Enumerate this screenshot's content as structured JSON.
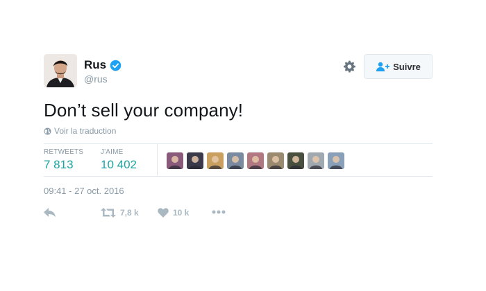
{
  "user": {
    "name": "Rus",
    "handle": "@rus",
    "avatar": "avatar"
  },
  "header": {
    "settings_icon": "gear-icon",
    "follow_label": "Suivre",
    "follow_icon": "add-user-icon"
  },
  "tweet": {
    "text": "Don’t sell your company!",
    "translate_label": "Voir la traduction",
    "timestamp": "09:41 - 27 oct. 2016"
  },
  "stats": {
    "retweets_label": "RETWEETS",
    "retweets_value": "7 813",
    "likes_label": "J'AIME",
    "likes_value": "10 402"
  },
  "likers": [
    {
      "name": "liker-1",
      "color": "#8a5a7a"
    },
    {
      "name": "liker-2",
      "color": "#3a3a4a"
    },
    {
      "name": "liker-3",
      "color": "#c9a060"
    },
    {
      "name": "liker-4",
      "color": "#7a8aa0"
    },
    {
      "name": "liker-5",
      "color": "#b07880"
    },
    {
      "name": "liker-6",
      "color": "#9a8a70"
    },
    {
      "name": "liker-7",
      "color": "#4a5040"
    },
    {
      "name": "liker-8",
      "color": "#a0a8b0"
    },
    {
      "name": "liker-9",
      "color": "#8aa0b8"
    }
  ],
  "actions": {
    "reply_icon": "reply-icon",
    "retweet_icon": "retweet-icon",
    "retweet_count": "7,8 k",
    "like_icon": "heart-icon",
    "like_count": "10 k",
    "more_icon": "more-icon"
  },
  "colors": {
    "stat_value": "#19a5a0",
    "verified": "#1da1f2",
    "muted": "#8899a6",
    "action": "#aab8c2",
    "follow_icon": "#1da1f2"
  }
}
